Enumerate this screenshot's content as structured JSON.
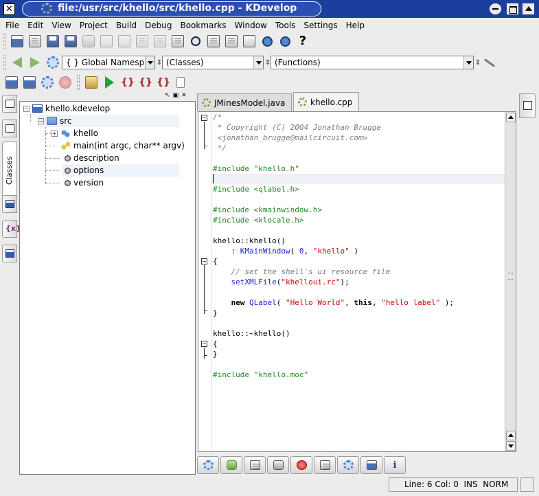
{
  "window": {
    "title": "file:/usr/src/khello/src/khello.cpp - KDevelop",
    "close_glyph": "✕",
    "icon": "kdevelop-gear-icon"
  },
  "menubar": {
    "items": [
      {
        "label": "File",
        "icon": null
      },
      {
        "label": "Edit",
        "icon": null
      },
      {
        "label": "View",
        "icon": null
      },
      {
        "label": "Project",
        "icon": null
      },
      {
        "label": "Build",
        "icon": null
      },
      {
        "label": "Debug",
        "icon": null
      },
      {
        "label": "Bookmarks",
        "icon": null
      },
      {
        "label": "Window",
        "icon": null
      },
      {
        "label": "Tools",
        "icon": null
      },
      {
        "label": "Settings",
        "icon": null
      },
      {
        "label": "Help",
        "icon": null
      }
    ]
  },
  "toolbar2": {
    "scope_combo": "Global Namespace)",
    "scope_prefix": "{ }",
    "classes_combo": "(Classes)",
    "functions_combo": "(Functions)"
  },
  "tree": {
    "rows": [
      {
        "label": "khello.kdevelop",
        "icon": "project-icon"
      },
      {
        "label": "src",
        "icon": "folder-icon"
      },
      {
        "label": "khello",
        "icon": "class-icon"
      },
      {
        "label": "main(int argc, char** argv)",
        "icon": "function-icon"
      },
      {
        "label": "description",
        "icon": "variable-icon"
      },
      {
        "label": "options",
        "icon": "variable-icon"
      },
      {
        "label": "version",
        "icon": "variable-icon"
      }
    ]
  },
  "side_tabs": {
    "classes_label": "Classes"
  },
  "editor": {
    "tabs": [
      {
        "label": "JMinesModel.java",
        "active": false
      },
      {
        "label": "khello.cpp",
        "active": true
      }
    ],
    "lines": [
      "/*",
      " * Copyright (C) 2004 Jonathan Brugge",
      " <jonathan_brugge@mailcircuit.com>",
      " */",
      "",
      "#include \"khello.h\"",
      "",
      "#include <qlabel.h>",
      "",
      "#include <kmainwindow.h>",
      "#include <klocale.h>",
      "",
      "khello::khello()",
      "    : KMainWindow( 0, \"khello\" )",
      "{",
      "    // set the shell's ui resource file",
      "    setXMLFile(\"khelloui.rc\");",
      "",
      "    new QLabel( \"Hello World\", this, \"hello label\" );",
      "}",
      "",
      "khello::~khello()",
      "{",
      "}",
      "",
      "#include \"khello.moc\""
    ]
  },
  "statusbar": {
    "position": "Line: 6 Col: 0  INS  NORM"
  },
  "colors": {
    "titlebar": "#1c3f9e",
    "preprocessor": "#1a8c1a",
    "string": "#d40000",
    "comment": "#7d7d7d",
    "number": "#1c1ccc"
  }
}
